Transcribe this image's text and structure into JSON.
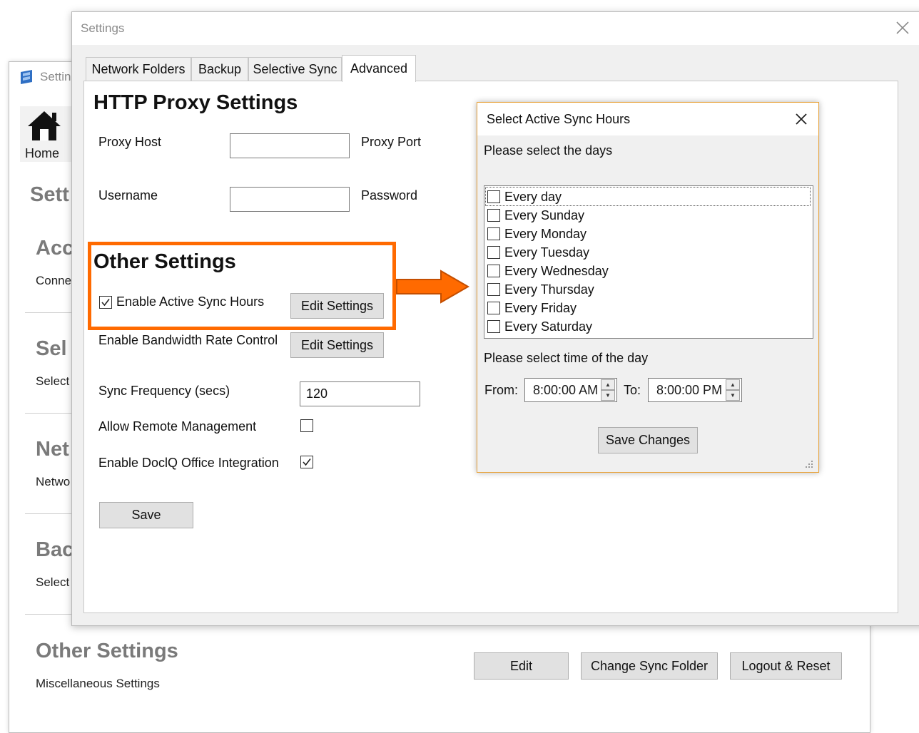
{
  "bg_window": {
    "title": "Settin",
    "home_label": "Home",
    "sections": [
      {
        "heading": "Sett",
        "sub": ""
      },
      {
        "heading": "Acc",
        "sub": "Conne"
      },
      {
        "heading": "Sel",
        "sub": "Select"
      },
      {
        "heading": "Net",
        "sub": "Netwo"
      },
      {
        "heading": "Bac",
        "sub": "Select"
      }
    ],
    "other": {
      "heading": "Other Settings",
      "sub": "Miscellaneous Settings"
    },
    "buttons": {
      "edit": "Edit",
      "change_sync": "Change Sync Folder",
      "logout": "Logout & Reset"
    }
  },
  "settings_window": {
    "title": "Settings",
    "tabs": [
      "Network Folders",
      "Backup",
      "Selective Sync",
      "Advanced"
    ],
    "active_tab": "Advanced",
    "proxy": {
      "heading": "HTTP Proxy Settings",
      "host_label": "Proxy Host",
      "host_value": "",
      "port_label": "Proxy Port",
      "username_label": "Username",
      "username_value": "",
      "password_label": "Password"
    },
    "other": {
      "heading": "Other Settings",
      "active_sync_label": "Enable Active Sync Hours",
      "active_sync_checked": true,
      "edit_settings_1": "Edit Settings",
      "bandwidth_label": "Enable Bandwidth Rate Control",
      "edit_settings_2": "Edit Settings",
      "sync_freq_label": "Sync Frequency (secs)",
      "sync_freq_value": "120",
      "remote_mgmt_label": "Allow Remote Management",
      "remote_mgmt_checked": false,
      "office_label": "Enable DoclQ Office Integration",
      "office_checked": true
    },
    "save_label": "Save"
  },
  "dialog": {
    "title": "Select Active Sync Hours",
    "days_prompt": "Please select the days",
    "days": [
      "Every day",
      "Every Sunday",
      "Every Monday",
      "Every Tuesday",
      "Every Wednesday",
      "Every Thursday",
      "Every Friday",
      "Every Saturday"
    ],
    "time_prompt": "Please select time of the day",
    "from_label": "From:",
    "from_value": "8:00:00 AM",
    "to_label": "To:",
    "to_value": "8:00:00 PM",
    "save_changes": "Save Changes"
  },
  "colors": {
    "highlight": "#ff6a00",
    "dialog_border": "#e8a33b"
  }
}
